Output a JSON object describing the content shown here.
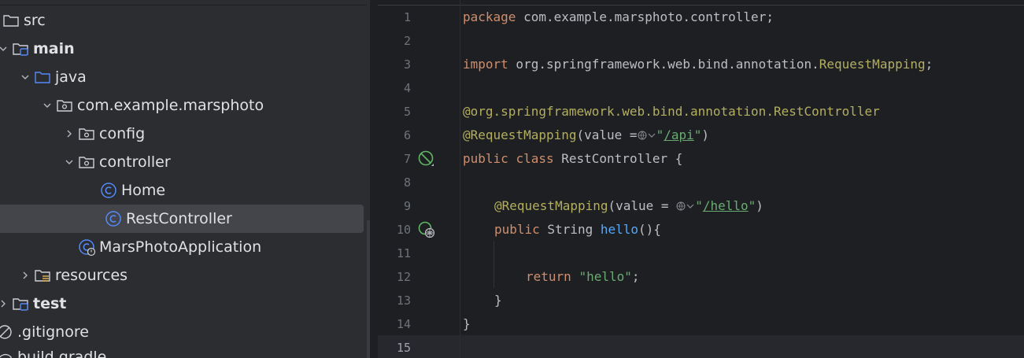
{
  "tree": {
    "items": [
      {
        "label": "src",
        "icon": "folder-icon"
      },
      {
        "label": "main",
        "icon": "source-root-folder-icon"
      },
      {
        "label": "java",
        "icon": "source-folder-icon"
      },
      {
        "label": "com.example.marsphoto",
        "icon": "package-icon"
      },
      {
        "label": "config",
        "icon": "package-icon"
      },
      {
        "label": "controller",
        "icon": "package-icon"
      },
      {
        "label": "Home",
        "icon": "class-icon"
      },
      {
        "label": "RestController",
        "icon": "class-icon",
        "selected": true
      },
      {
        "label": "MarsPhotoApplication",
        "icon": "spring-boot-class-icon"
      },
      {
        "label": "resources",
        "icon": "resources-folder-icon"
      },
      {
        "label": "test",
        "icon": "source-root-folder-icon"
      },
      {
        "label": ".gitignore",
        "icon": "ignored-file-icon"
      },
      {
        "label": "build.gradle",
        "icon": "gradle-icon"
      }
    ]
  },
  "editor": {
    "line_numbers": [
      "1",
      "2",
      "3",
      "4",
      "5",
      "6",
      "7",
      "8",
      "9",
      "10",
      "11",
      "12",
      "13",
      "14",
      "15"
    ],
    "current_line": "15",
    "code": {
      "l1_kw": "package",
      "l1_rest": " com.example.marsphoto.controller;",
      "l3_kw": "import",
      "l3_pkg": " org.springframework.web.bind.annotation.",
      "l3_cls": "RequestMapping",
      "l3_end": ";",
      "l5_prefix": "@org.springframework.web.bind.annotation.",
      "l5_cls": "RestController",
      "l6_ann": "@RequestMapping",
      "l6_mid": "(value =",
      "l6_q1": "\"",
      "l6_url": "/api",
      "l6_q2": "\"",
      "l6_end": ")",
      "l7_kw1": "public",
      "l7_kw2": "class",
      "l7_rest": " RestController {",
      "l9_ann": "@RequestMapping",
      "l9_mid": "(value = ",
      "l9_q1": "\"",
      "l9_url": "/hello",
      "l9_q2": "\"",
      "l9_end": ")",
      "l10_kw": "public",
      "l10_type": " String ",
      "l10_fn": "hello",
      "l10_end": "(){",
      "l12_kw": "return",
      "l12_str": "\"hello\"",
      "l12_end": ";",
      "l13": "}",
      "l14": "}"
    }
  }
}
